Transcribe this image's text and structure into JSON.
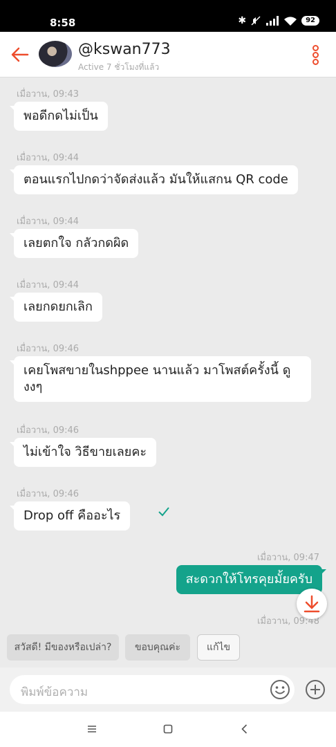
{
  "status_bar": {
    "time": "8:58",
    "battery": "92"
  },
  "header": {
    "username": "@kswan773",
    "status": "Active 7 ชั่วโมงที่แล้ว"
  },
  "messages": [
    {
      "time": "เมื่อวาน, 09:43",
      "text": "พอดีกดไม่เป็น",
      "direction": "in"
    },
    {
      "time": "เมื่อวาน, 09:44",
      "text": "ตอนแรกไปกดว่าจัดส่งแล้ว มันให้แสกน QR code",
      "direction": "in"
    },
    {
      "time": "เมื่อวาน, 09:44",
      "text": "เลยตกใจ กลัวกดผิด",
      "direction": "in"
    },
    {
      "time": "เมื่อวาน, 09:44",
      "text": "เลยกดยกเลิก",
      "direction": "in"
    },
    {
      "time": "เมื่อวาน, 09:46",
      "text": "เคยโพสขายในshppee นานแล้ว มาโพสต์ครั้งนี้ ดูงงๆ",
      "direction": "in"
    },
    {
      "time": "เมื่อวาน, 09:46",
      "text": "ไม่เข้าใจ วิธีขายเลยคะ",
      "direction": "in"
    },
    {
      "time": "เมื่อวาน, 09:46",
      "text": "Drop off คืออะไร",
      "direction": "in"
    },
    {
      "time": "เมื่อวาน, 09:47",
      "text": "สะดวกให้โทรคุยมั้ยครับ",
      "direction": "out"
    }
  ],
  "partial_time": "เมื่อวาน, 09:48",
  "quick_replies": [
    "สวัสดี! มีของหรือเปล่า?",
    "ขอบคุณค่ะ",
    "แก้ไข"
  ],
  "input": {
    "placeholder": "พิมพ์ข้อความ"
  },
  "colors": {
    "accent": "#ee4d2d",
    "sent_bubble": "#14a38b",
    "background": "#ebebeb"
  }
}
